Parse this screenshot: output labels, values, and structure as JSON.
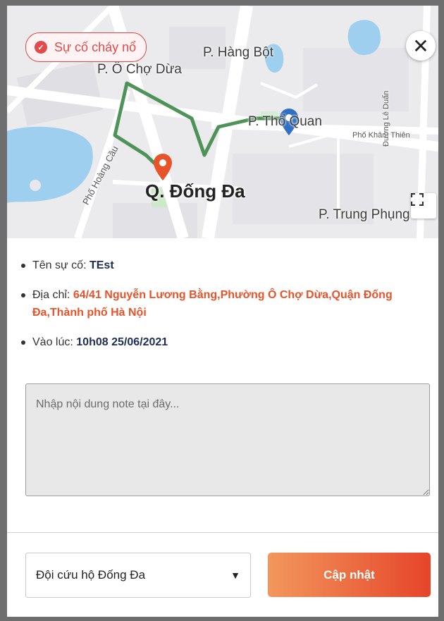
{
  "badge": {
    "label": "Sự cố cháy nổ",
    "icon": "alert-circle-icon",
    "color": "#e24b4b"
  },
  "map": {
    "labels": {
      "hang_bot": "P. Hàng Bột",
      "o_cho_dua": "P. Ô Chợ Dừa",
      "tho_quan": "P. Thổ Quan",
      "kham_thien": "Phố Khâm Thiên",
      "le_duan": "Đường Lê Duẩn",
      "hoang_cau": "Phố Hoàng Cầu",
      "dong_da": "Q. Đống Đa",
      "trung_phung": "P. Trung Phụng"
    },
    "route_color": "#3f8a4a",
    "origin_marker_color": "#e8532a",
    "destination_marker_color": "#2f6fc4"
  },
  "details": {
    "name_label": "Tên sự cố:",
    "name_value": "TEst",
    "address_label": "Địa chỉ:",
    "address_value": "64/41 Nguyễn Lương Bằng,Phường Ô Chợ Dừa,Quận Đống Đa,Thành phố Hà Nội",
    "time_label": "Vào lúc:",
    "time_value": "10h08 25/06/2021"
  },
  "note": {
    "placeholder": "Nhập nội dung note tại đây..."
  },
  "footer": {
    "team_select_value": "Đội cứu hộ Đống Đa",
    "update_label": "Cập nhật",
    "accent": "#e6452a"
  }
}
